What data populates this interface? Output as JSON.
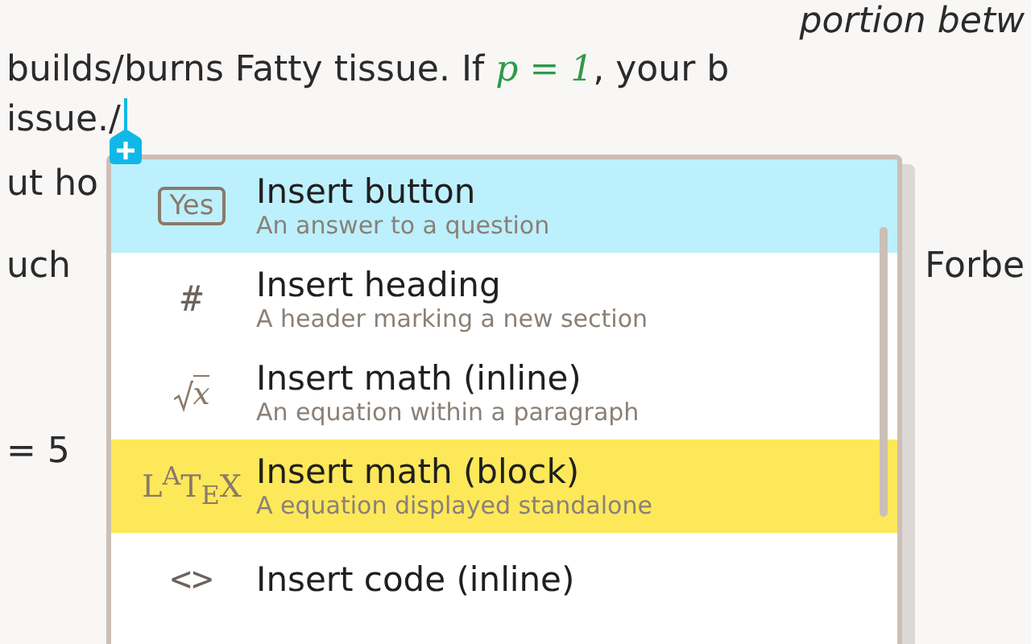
{
  "document": {
    "lines": [
      {
        "right": "portion betw",
        "right_italic": true
      },
      {
        "left": "builds/burns Fatty tissue. If ",
        "math": "p = 1",
        "after": ", your b"
      },
      {
        "left": "issue./",
        "caret": true
      },
      {
        "left": "ut ho"
      },
      {
        "left": "uch",
        "right": "Forbe"
      },
      {
        "left": "= 5"
      }
    ]
  },
  "insert_menu": {
    "items": [
      {
        "kind": "boxed",
        "icon": "Yes",
        "title": "Insert button",
        "description": "An answer to a question",
        "hovered": true,
        "selected": false
      },
      {
        "kind": "symbol",
        "icon": "#",
        "title": "Insert heading",
        "description": "A header marking a new section",
        "hovered": false,
        "selected": false
      },
      {
        "kind": "sqrt",
        "icon": "x",
        "title": "Insert math (inline)",
        "description": "An equation within a paragraph",
        "hovered": false,
        "selected": false
      },
      {
        "kind": "latex",
        "icon": "L$^{A}$T$_{E}$X",
        "title": "Insert math (block)",
        "description": "A equation displayed standalone",
        "hovered": false,
        "selected": true
      },
      {
        "kind": "symbol",
        "icon": "<>",
        "title": "Insert code (inline)",
        "hovered": false,
        "selected": false
      }
    ]
  }
}
